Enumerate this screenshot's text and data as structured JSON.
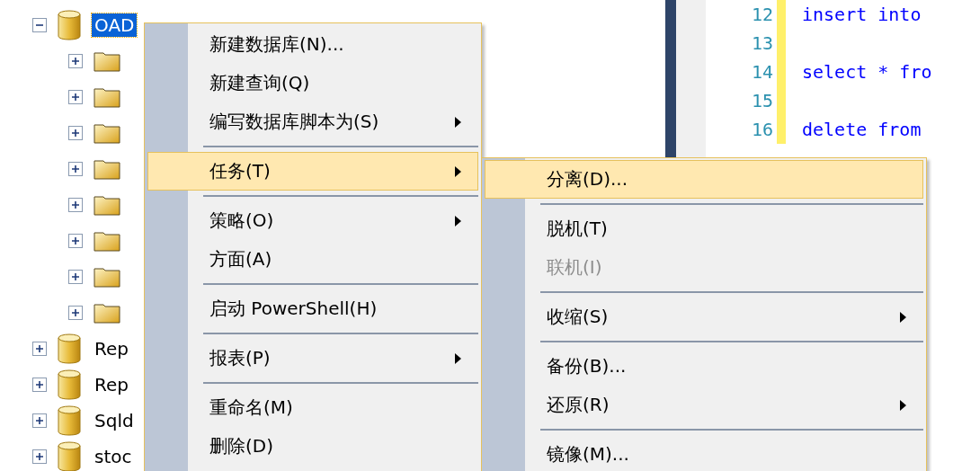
{
  "tree": {
    "items": [
      {
        "label": "OAD",
        "kind": "database",
        "expanded": true,
        "selected": true,
        "children": [
          {
            "kind": "folder",
            "expanded": false
          },
          {
            "kind": "folder",
            "expanded": false
          },
          {
            "kind": "folder",
            "expanded": false
          },
          {
            "kind": "folder",
            "expanded": false
          },
          {
            "kind": "folder",
            "expanded": false
          },
          {
            "kind": "folder",
            "expanded": false
          },
          {
            "kind": "folder",
            "expanded": false
          },
          {
            "kind": "folder",
            "expanded": false
          }
        ]
      },
      {
        "label": "Rep",
        "kind": "database",
        "expanded": false,
        "selected": false
      },
      {
        "label": "Rep",
        "kind": "database",
        "expanded": false,
        "selected": false
      },
      {
        "label": "Sqld",
        "kind": "database",
        "expanded": false,
        "selected": false
      },
      {
        "label": "stoc",
        "kind": "database",
        "expanded": false,
        "selected": false
      }
    ]
  },
  "editor": {
    "lines": [
      {
        "number": "12",
        "code": "insert into"
      },
      {
        "number": "13"
      },
      {
        "number": "14",
        "code": "select * fro"
      },
      {
        "number": "15"
      },
      {
        "number": "16",
        "code": "delete from"
      }
    ]
  },
  "context_menu": {
    "items": [
      {
        "kind": "item",
        "label": "新建数据库(N)...",
        "submenu": false,
        "selected": false,
        "disabled": false
      },
      {
        "kind": "item",
        "label": "新建查询(Q)",
        "submenu": false,
        "selected": false,
        "disabled": false
      },
      {
        "kind": "item",
        "label": "编写数据库脚本为(S)",
        "submenu": true,
        "selected": false,
        "disabled": false
      },
      {
        "kind": "separator"
      },
      {
        "kind": "item",
        "label": "任务(T)",
        "submenu": true,
        "selected": true,
        "disabled": false
      },
      {
        "kind": "separator"
      },
      {
        "kind": "item",
        "label": "策略(O)",
        "submenu": true,
        "selected": false,
        "disabled": false
      },
      {
        "kind": "item",
        "label": "方面(A)",
        "submenu": false,
        "selected": false,
        "disabled": false
      },
      {
        "kind": "separator"
      },
      {
        "kind": "item",
        "label": "启动 PowerShell(H)",
        "submenu": false,
        "selected": false,
        "disabled": false
      },
      {
        "kind": "separator"
      },
      {
        "kind": "item",
        "label": "报表(P)",
        "submenu": true,
        "selected": false,
        "disabled": false
      },
      {
        "kind": "separator"
      },
      {
        "kind": "item",
        "label": "重命名(M)",
        "submenu": false,
        "selected": false,
        "disabled": false
      },
      {
        "kind": "item",
        "label": "删除(D)",
        "submenu": false,
        "selected": false,
        "disabled": false
      }
    ]
  },
  "submenu": {
    "items": [
      {
        "kind": "item",
        "label": "分离(D)...",
        "submenu": false,
        "selected": true,
        "disabled": false
      },
      {
        "kind": "separator"
      },
      {
        "kind": "item",
        "label": "脱机(T)",
        "submenu": false,
        "selected": false,
        "disabled": false
      },
      {
        "kind": "item",
        "label": "联机(I)",
        "submenu": false,
        "selected": false,
        "disabled": true
      },
      {
        "kind": "separator"
      },
      {
        "kind": "item",
        "label": "收缩(S)",
        "submenu": true,
        "selected": false,
        "disabled": false
      },
      {
        "kind": "separator"
      },
      {
        "kind": "item",
        "label": "备份(B)...",
        "submenu": false,
        "selected": false,
        "disabled": false
      },
      {
        "kind": "item",
        "label": "还原(R)",
        "submenu": true,
        "selected": false,
        "disabled": false
      },
      {
        "kind": "separator"
      },
      {
        "kind": "item",
        "label": "镜像(M)...",
        "submenu": false,
        "selected": false,
        "disabled": false
      }
    ]
  }
}
